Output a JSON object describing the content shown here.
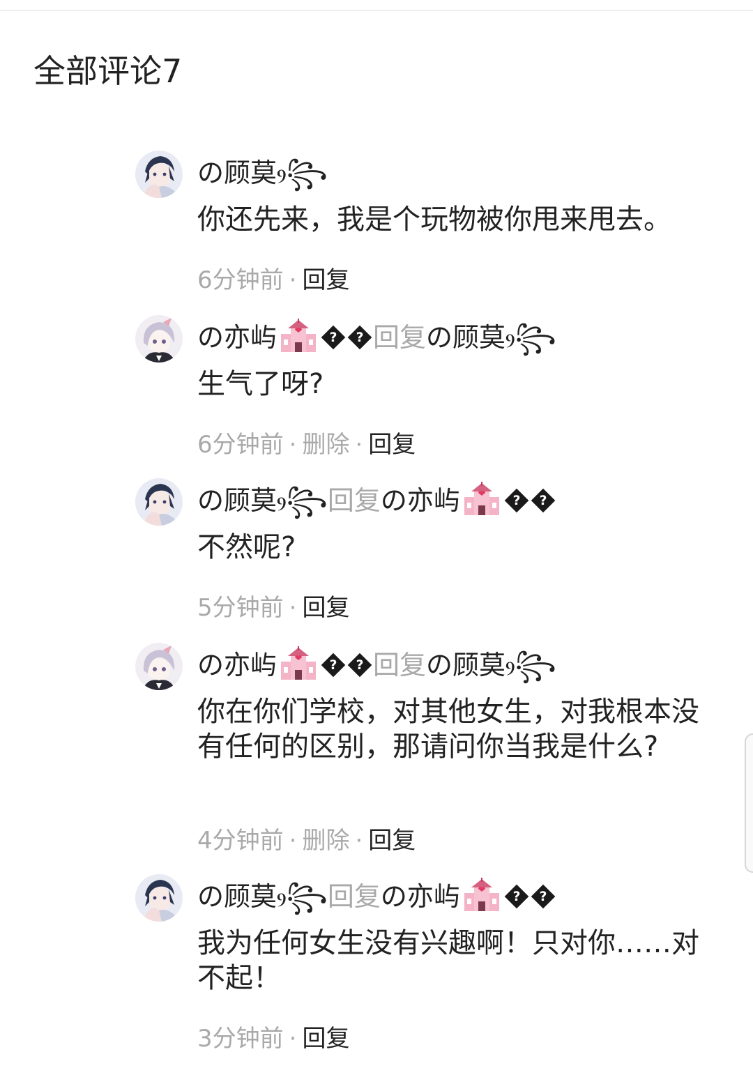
{
  "header": {
    "title": "全部评论7"
  },
  "comments": [
    {
      "author": "の顾莫ⳋ꧂",
      "reply_to": "",
      "text": "你还先来，我是个玩物被你甩来甩去。",
      "time": "6分钟前",
      "can_delete": false,
      "delete_label": "",
      "reply_label": "回复"
    },
    {
      "author": "の亦屿",
      "author_emoji": "church-icon",
      "author_glyphs": "��",
      "reply_word": "回复",
      "reply_to": "の顾莫ⳋ꧂",
      "text": "生气了呀?",
      "time": "6分钟前",
      "can_delete": true,
      "delete_label": "删除",
      "reply_label": "回复"
    },
    {
      "author": "の顾莫ⳋ꧂",
      "reply_word": "回复",
      "reply_to": "の亦屿",
      "reply_to_emoji": "church-icon",
      "reply_to_glyphs": "��",
      "text": "不然呢?",
      "time": "5分钟前",
      "can_delete": false,
      "delete_label": "",
      "reply_label": "回复"
    },
    {
      "author": "の亦屿",
      "author_emoji": "church-icon",
      "author_glyphs": "��",
      "reply_word": "回复",
      "reply_to": "の顾莫ⳋ꧂",
      "text": "你在你们学校，对其他女生，对我根本没有任何的区别，那请问你当我是什么?",
      "time": "4分钟前",
      "can_delete": true,
      "delete_label": "删除",
      "reply_label": "回复"
    },
    {
      "author": "の顾莫ⳋ꧂",
      "reply_word": "回复",
      "reply_to": "の亦屿",
      "reply_to_emoji": "church-icon",
      "reply_to_glyphs": "��",
      "text": "我为任何女生没有兴趣啊！只对你……对不起！",
      "time": "3分钟前",
      "can_delete": false,
      "delete_label": "",
      "reply_label": "回复"
    }
  ],
  "meta": {
    "separator": "·"
  },
  "colors": {
    "text": "#222222",
    "muted": "#a9a9a9",
    "background": "#ffffff"
  }
}
